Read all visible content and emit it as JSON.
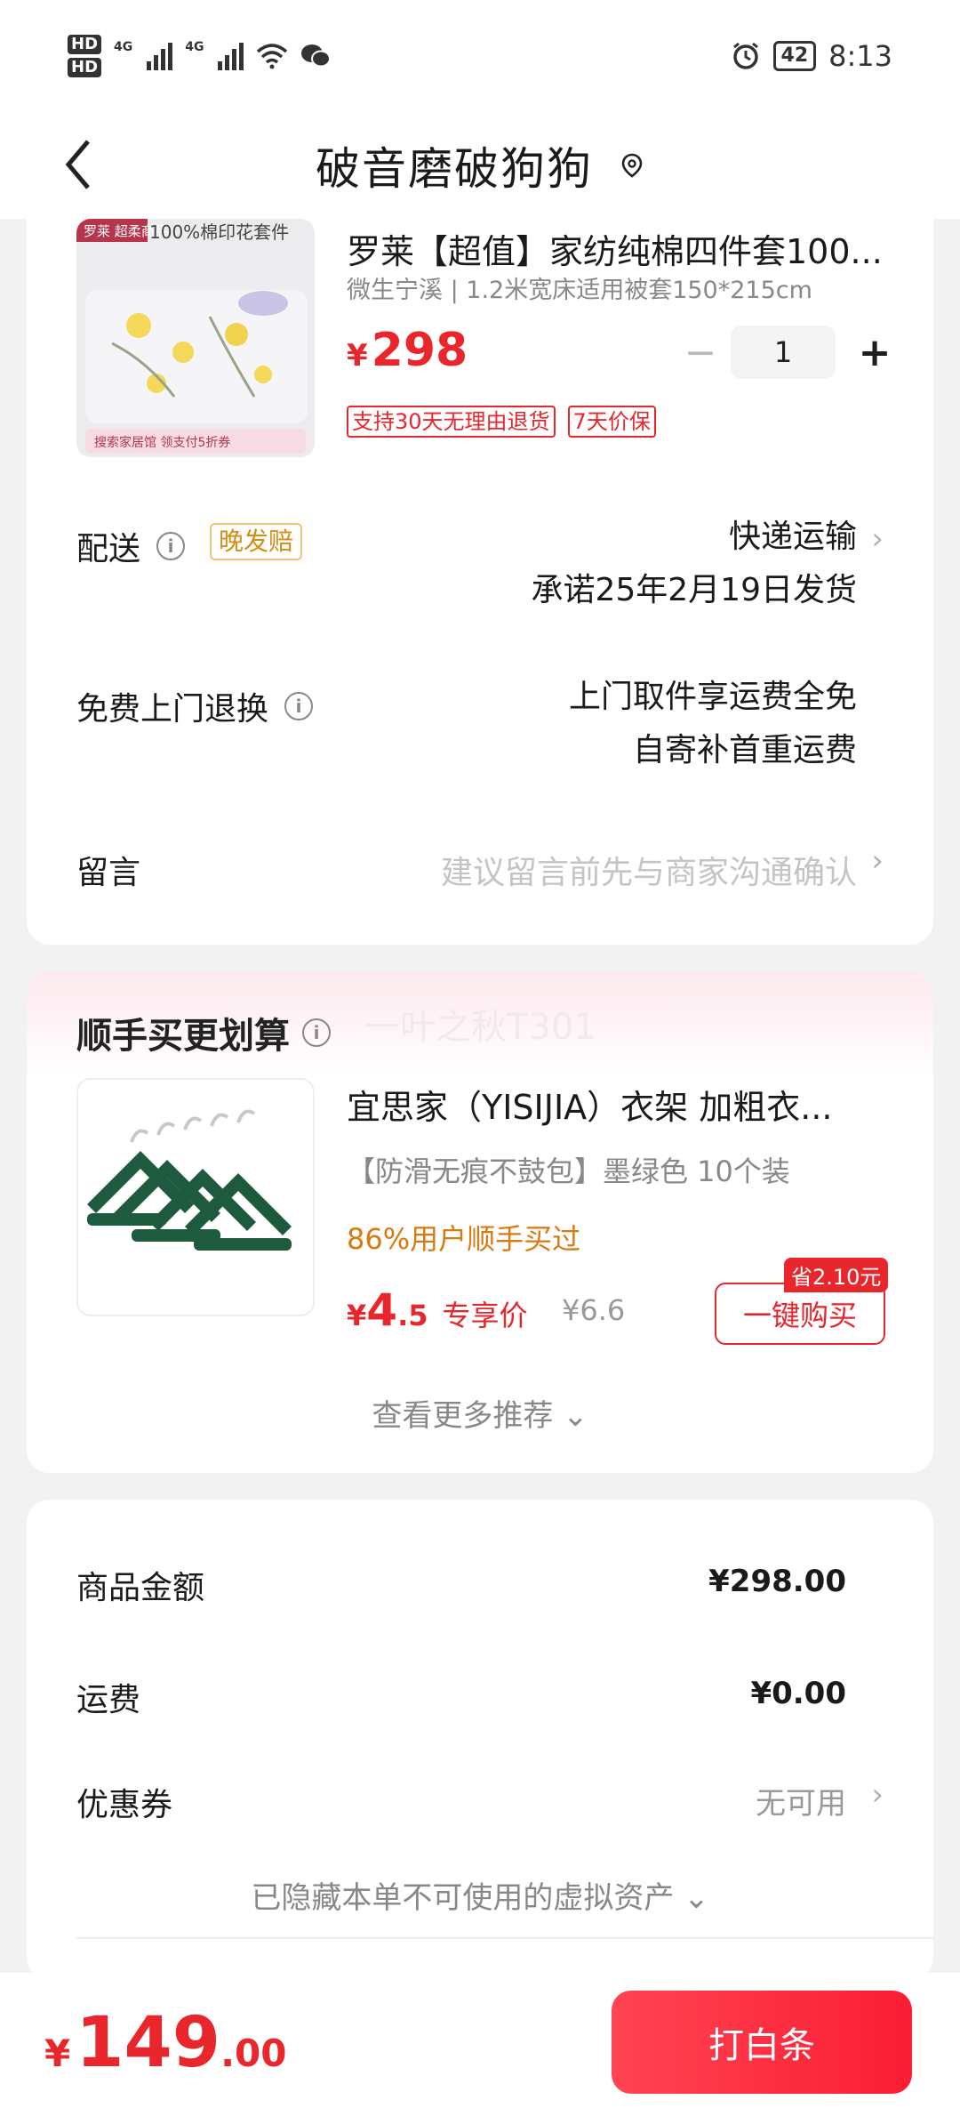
{
  "status_bar": {
    "hd1": "HD",
    "hd2": "HD",
    "net1": "4G",
    "net2": "4G",
    "battery": "42",
    "time": "8:13",
    "icons": [
      "signal-icon",
      "wifi-icon",
      "wechat-icon",
      "alarm-icon",
      "battery-icon"
    ]
  },
  "nav": {
    "title": "破音磨破狗狗",
    "back_icon": "chevron-left-icon",
    "location_icon": "location-pin-icon"
  },
  "product": {
    "image_label": "罗莱 超柔商品 100%棉印花套件",
    "title": "罗莱【超值】家纺纯棉四件套100...",
    "spec": "微生宁溪 | 1.2米宽床适用被套150*215cm",
    "price_symbol": "¥",
    "price": "298",
    "quantity": "1",
    "minus": "−",
    "plus": "+",
    "tags": [
      "支持30天无理由退货",
      "7天价保"
    ]
  },
  "delivery": {
    "label": "配送",
    "badge": "晚发赔",
    "method": "快递运输",
    "promise": "承诺25年2月19日发货"
  },
  "return": {
    "label": "免费上门退换",
    "line1": "上门取件享运费全免",
    "line2": "自寄补首重运费"
  },
  "message": {
    "label": "留言",
    "placeholder": "建议留言前先与商家沟通确认"
  },
  "recommend": {
    "section_title": "顺手买更划算",
    "watermark": "一叶之秋T301",
    "title": "宜思家（YISIJIA）衣架 加粗衣...",
    "sub": "【防滑无痕不鼓包】墨绿色   10个装",
    "social": "86%用户顺手买过",
    "price_symbol": "¥",
    "price_int": "4",
    "price_dec": ".5",
    "price_label": "专享价",
    "orig_price": "¥6.6",
    "save_badge": "省2.10元",
    "buy_label": "一键购买",
    "more_label": "查看更多推荐"
  },
  "summary": {
    "goods_label": "商品金额",
    "goods_value": "¥298.00",
    "shipping_label": "运费",
    "shipping_value": "¥0.00",
    "coupon_label": "优惠券",
    "coupon_value": "无可用",
    "hidden_assets": "已隐藏本单不可使用的虚拟资产"
  },
  "checkout": {
    "symbol": "¥",
    "total_int": "149",
    "total_dec": ".00",
    "pay_label": "打白条"
  },
  "colors": {
    "accent": "#e8262c",
    "orange": "#d9790f",
    "muted": "#888888",
    "bg": "#f2f2f2"
  }
}
